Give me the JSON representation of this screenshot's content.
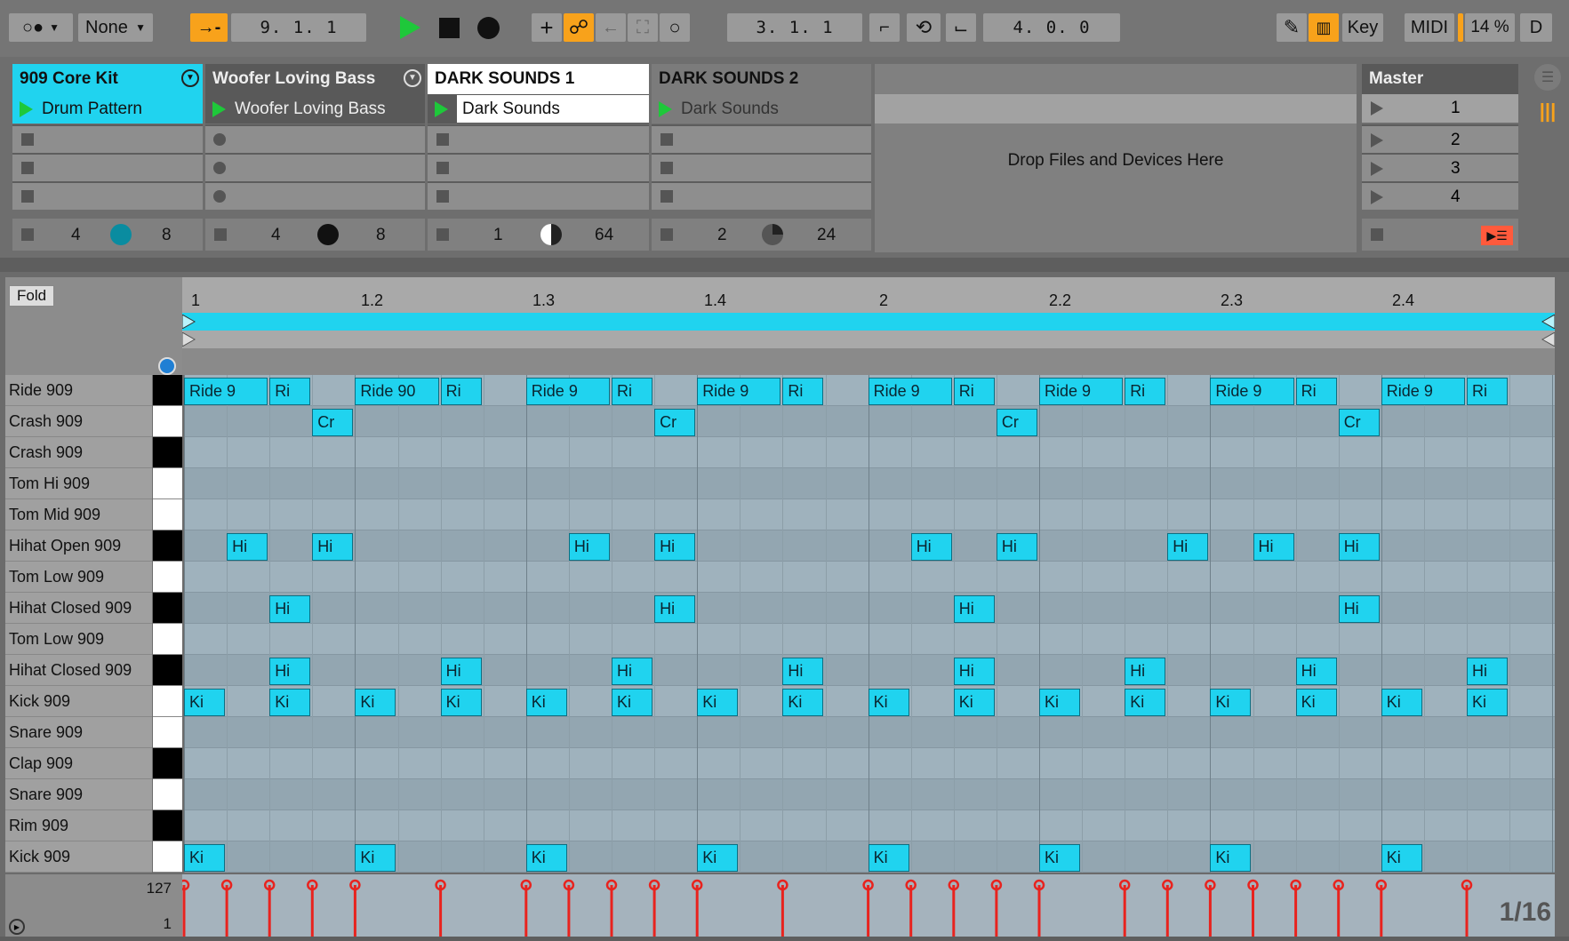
{
  "transport": {
    "mode_selector": "None",
    "arrangement_position": "9.  1.  1",
    "loop_start": "3.  1.  1",
    "loop_length": "4.  0.  0",
    "key_label": "Key",
    "midi_label": "MIDI",
    "cpu_load": "14 %",
    "d_label": "D"
  },
  "session": {
    "tracks": [
      {
        "name": "909 Core Kit",
        "clip": "Drum Pattern",
        "stop_left": "4",
        "stop_right": "8"
      },
      {
        "name": "Woofer Loving Bass",
        "clip": "Woofer Loving Bass",
        "stop_left": "4",
        "stop_right": "8"
      },
      {
        "name": "DARK SOUNDS 1",
        "clip": "Dark Sounds",
        "stop_left": "1",
        "stop_right": "64"
      },
      {
        "name": "DARK SOUNDS 2",
        "clip": "Dark Sounds",
        "stop_left": "2",
        "stop_right": "24"
      }
    ],
    "drop_hint": "Drop Files and Devices Here",
    "master": {
      "name": "Master",
      "scenes": [
        "1",
        "2",
        "3",
        "4"
      ]
    }
  },
  "editor": {
    "fold_label": "Fold",
    "ruler": [
      "1",
      "1.2",
      "1.3",
      "1.4",
      "2",
      "2.2",
      "2.3",
      "2.4"
    ],
    "rows": [
      {
        "name": "Ride 909",
        "black": true
      },
      {
        "name": "Crash 909",
        "black": false
      },
      {
        "name": "Crash 909",
        "black": true
      },
      {
        "name": "Tom Hi 909",
        "black": false
      },
      {
        "name": "Tom Mid 909",
        "black": false
      },
      {
        "name": "Hihat Open 909",
        "black": true
      },
      {
        "name": "Tom Low 909",
        "black": false
      },
      {
        "name": "Hihat Closed 909",
        "black": true
      },
      {
        "name": "Tom Low 909",
        "black": false
      },
      {
        "name": "Hihat Closed 909",
        "black": true
      },
      {
        "name": "Kick 909",
        "black": false
      },
      {
        "name": "Snare 909",
        "black": false
      },
      {
        "name": "Clap 909",
        "black": true
      },
      {
        "name": "Snare 909",
        "black": false
      },
      {
        "name": "Rim 909",
        "black": true
      },
      {
        "name": "Kick 909",
        "black": false
      }
    ],
    "notes": [
      {
        "row": 0,
        "step": 0,
        "len": 2,
        "label": "Ride 9"
      },
      {
        "row": 0,
        "step": 2,
        "len": 1,
        "label": "Ri"
      },
      {
        "row": 0,
        "step": 4,
        "len": 2,
        "label": "Ride 90"
      },
      {
        "row": 0,
        "step": 6,
        "len": 1,
        "label": "Ri"
      },
      {
        "row": 0,
        "step": 8,
        "len": 2,
        "label": "Ride 9"
      },
      {
        "row": 0,
        "step": 10,
        "len": 1,
        "label": "Ri"
      },
      {
        "row": 0,
        "step": 12,
        "len": 2,
        "label": "Ride 9"
      },
      {
        "row": 0,
        "step": 14,
        "len": 1,
        "label": "Ri"
      },
      {
        "row": 0,
        "step": 16,
        "len": 2,
        "label": "Ride 9"
      },
      {
        "row": 0,
        "step": 18,
        "len": 1,
        "label": "Ri"
      },
      {
        "row": 0,
        "step": 20,
        "len": 2,
        "label": "Ride 9"
      },
      {
        "row": 0,
        "step": 22,
        "len": 1,
        "label": "Ri"
      },
      {
        "row": 0,
        "step": 24,
        "len": 2,
        "label": "Ride 9"
      },
      {
        "row": 0,
        "step": 26,
        "len": 1,
        "label": "Ri"
      },
      {
        "row": 0,
        "step": 28,
        "len": 2,
        "label": "Ride 9"
      },
      {
        "row": 0,
        "step": 30,
        "len": 1,
        "label": "Ri"
      },
      {
        "row": 1,
        "step": 3,
        "len": 1,
        "label": "Cr"
      },
      {
        "row": 1,
        "step": 11,
        "len": 1,
        "label": "Cr"
      },
      {
        "row": 1,
        "step": 19,
        "len": 1,
        "label": "Cr"
      },
      {
        "row": 1,
        "step": 27,
        "len": 1,
        "label": "Cr"
      },
      {
        "row": 5,
        "step": 1,
        "len": 1,
        "label": "Hi"
      },
      {
        "row": 5,
        "step": 3,
        "len": 1,
        "label": "Hi"
      },
      {
        "row": 5,
        "step": 9,
        "len": 1,
        "label": "Hi"
      },
      {
        "row": 5,
        "step": 11,
        "len": 1,
        "label": "Hi"
      },
      {
        "row": 5,
        "step": 17,
        "len": 1,
        "label": "Hi"
      },
      {
        "row": 5,
        "step": 19,
        "len": 1,
        "label": "Hi"
      },
      {
        "row": 5,
        "step": 23,
        "len": 1,
        "label": "Hi"
      },
      {
        "row": 5,
        "step": 25,
        "len": 1,
        "label": "Hi"
      },
      {
        "row": 5,
        "step": 27,
        "len": 1,
        "label": "Hi"
      },
      {
        "row": 7,
        "step": 2,
        "len": 1,
        "label": "Hi"
      },
      {
        "row": 7,
        "step": 11,
        "len": 1,
        "label": "Hi"
      },
      {
        "row": 7,
        "step": 18,
        "len": 1,
        "label": "Hi"
      },
      {
        "row": 7,
        "step": 27,
        "len": 1,
        "label": "Hi"
      },
      {
        "row": 9,
        "step": 2,
        "len": 1,
        "label": "Hi"
      },
      {
        "row": 9,
        "step": 6,
        "len": 1,
        "label": "Hi"
      },
      {
        "row": 9,
        "step": 10,
        "len": 1,
        "label": "Hi"
      },
      {
        "row": 9,
        "step": 14,
        "len": 1,
        "label": "Hi"
      },
      {
        "row": 9,
        "step": 18,
        "len": 1,
        "label": "Hi"
      },
      {
        "row": 9,
        "step": 22,
        "len": 1,
        "label": "Hi"
      },
      {
        "row": 9,
        "step": 26,
        "len": 1,
        "label": "Hi"
      },
      {
        "row": 9,
        "step": 30,
        "len": 1,
        "label": "Hi"
      },
      {
        "row": 10,
        "step": 0,
        "len": 1,
        "label": "Ki"
      },
      {
        "row": 10,
        "step": 2,
        "len": 1,
        "label": "Ki"
      },
      {
        "row": 10,
        "step": 4,
        "len": 1,
        "label": "Ki"
      },
      {
        "row": 10,
        "step": 6,
        "len": 1,
        "label": "Ki"
      },
      {
        "row": 10,
        "step": 8,
        "len": 1,
        "label": "Ki"
      },
      {
        "row": 10,
        "step": 10,
        "len": 1,
        "label": "Ki"
      },
      {
        "row": 10,
        "step": 12,
        "len": 1,
        "label": "Ki"
      },
      {
        "row": 10,
        "step": 14,
        "len": 1,
        "label": "Ki"
      },
      {
        "row": 10,
        "step": 16,
        "len": 1,
        "label": "Ki"
      },
      {
        "row": 10,
        "step": 18,
        "len": 1,
        "label": "Ki"
      },
      {
        "row": 10,
        "step": 20,
        "len": 1,
        "label": "Ki"
      },
      {
        "row": 10,
        "step": 22,
        "len": 1,
        "label": "Ki"
      },
      {
        "row": 10,
        "step": 24,
        "len": 1,
        "label": "Ki"
      },
      {
        "row": 10,
        "step": 26,
        "len": 1,
        "label": "Ki"
      },
      {
        "row": 10,
        "step": 28,
        "len": 1,
        "label": "Ki"
      },
      {
        "row": 10,
        "step": 30,
        "len": 1,
        "label": "Ki"
      },
      {
        "row": 15,
        "step": 0,
        "len": 1,
        "label": "Ki"
      },
      {
        "row": 15,
        "step": 4,
        "len": 1,
        "label": "Ki"
      },
      {
        "row": 15,
        "step": 8,
        "len": 1,
        "label": "Ki"
      },
      {
        "row": 15,
        "step": 12,
        "len": 1,
        "label": "Ki"
      },
      {
        "row": 15,
        "step": 16,
        "len": 1,
        "label": "Ki"
      },
      {
        "row": 15,
        "step": 20,
        "len": 1,
        "label": "Ki"
      },
      {
        "row": 15,
        "step": 24,
        "len": 1,
        "label": "Ki"
      },
      {
        "row": 15,
        "step": 28,
        "len": 1,
        "label": "Ki"
      }
    ],
    "velocity_max": "127",
    "velocity_min": "1",
    "grid_label": "1/16",
    "velocity_steps": [
      0,
      1,
      2,
      3,
      4,
      6,
      8,
      9,
      10,
      11,
      12,
      14,
      16,
      17,
      18,
      19,
      20,
      22,
      23,
      24,
      25,
      26,
      27,
      28,
      30
    ]
  },
  "colors": {
    "accent": "#20d3ef",
    "play": "#1ec83a",
    "record_stop": "#ff5a3c",
    "velocity": "#e8231e"
  }
}
